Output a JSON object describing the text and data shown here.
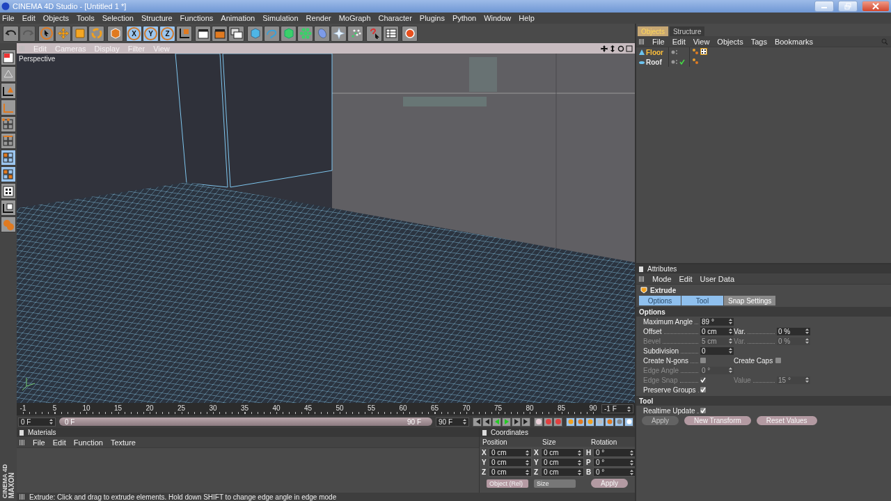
{
  "window": {
    "title": "CINEMA 4D Studio - [Untitled 1 *]"
  },
  "menu": [
    "File",
    "Edit",
    "Objects",
    "Tools",
    "Selection",
    "Structure",
    "Functions",
    "Animation",
    "Simulation",
    "Render",
    "MoGraph",
    "Character",
    "Plugins",
    "Python",
    "Window",
    "Help"
  ],
  "toolbar": [
    [
      {
        "kind": "undo",
        "active": false
      },
      {
        "kind": "redo",
        "active": false
      }
    ],
    [
      {
        "kind": "select",
        "active": false
      },
      {
        "kind": "move",
        "active": false
      },
      {
        "kind": "scale",
        "active": false
      },
      {
        "kind": "rotate",
        "active": false
      }
    ],
    [
      {
        "kind": "object",
        "active": false
      }
    ],
    [
      {
        "kind": "axis",
        "label": "X",
        "active": true
      },
      {
        "kind": "axis",
        "label": "Y",
        "active": true
      },
      {
        "kind": "axis",
        "label": "Z",
        "active": true
      },
      {
        "kind": "coords",
        "active": false
      }
    ],
    [
      {
        "kind": "render-view",
        "active": false
      },
      {
        "kind": "render",
        "active": false
      },
      {
        "kind": "render-settings",
        "active": false
      }
    ],
    [
      {
        "kind": "cube",
        "active": false
      },
      {
        "kind": "spline",
        "active": false
      },
      {
        "kind": "nurbs",
        "active": false
      },
      {
        "kind": "array",
        "active": false
      },
      {
        "kind": "deformer",
        "active": false
      },
      {
        "kind": "light",
        "active": false
      },
      {
        "kind": "particles",
        "active": false
      }
    ],
    [
      {
        "kind": "help",
        "active": false
      },
      {
        "kind": "layout",
        "active": false
      }
    ],
    [
      {
        "kind": "record",
        "active": false
      }
    ]
  ],
  "left_tools": [
    {
      "kind": "layout",
      "active": false
    },
    {
      "kind": "texture",
      "active": false
    },
    {
      "kind": "object-axis",
      "active": false
    },
    {
      "kind": "model",
      "active": false
    },
    {
      "kind": "points",
      "active": false
    },
    {
      "kind": "edges",
      "active": false
    },
    {
      "kind": "polygons",
      "active": true
    },
    {
      "kind": "uv",
      "active": true
    },
    {
      "kind": "checker",
      "active": false
    },
    {
      "kind": "checker-axis",
      "active": false
    },
    {
      "kind": "sculpt",
      "active": false
    }
  ],
  "viewport": {
    "menu": [
      "Edit",
      "Cameras",
      "Display",
      "Filter",
      "View"
    ],
    "label": "Perspective"
  },
  "timeline": {
    "ticks": [
      "-1",
      "5",
      "10",
      "15",
      "20",
      "25",
      "30",
      "35",
      "40",
      "45",
      "50",
      "55",
      "60",
      "65",
      "70",
      "75",
      "80",
      "85",
      "90"
    ],
    "frame_field": "-1 F",
    "start_field": "0 F",
    "range": {
      "start": "0 F",
      "end": "90 F",
      "level": 1
    },
    "end_field": "90 F"
  },
  "materials": {
    "title": "Materials",
    "menu": [
      "File",
      "Edit",
      "Function",
      "Texture"
    ]
  },
  "coordinates": {
    "title": "Coordinates",
    "headers": [
      "Position",
      "Size",
      "Rotation"
    ],
    "rows": [
      [
        {
          "axis": "X",
          "value": "0 cm"
        },
        {
          "axis": "X",
          "value": "0 cm"
        },
        {
          "axis": "H",
          "value": "0 °"
        }
      ],
      [
        {
          "axis": "Y",
          "value": "0 cm"
        },
        {
          "axis": "Y",
          "value": "0 cm"
        },
        {
          "axis": "P",
          "value": "0 °"
        }
      ],
      [
        {
          "axis": "Z",
          "value": "0 cm"
        },
        {
          "axis": "Z",
          "value": "0 cm"
        },
        {
          "axis": "B",
          "value": "0 °"
        }
      ]
    ],
    "mode": "Object (Rel)",
    "size_mode": "Size",
    "apply": "Apply"
  },
  "status": "Extrude: Click and drag to extrude elements. Hold down SHIFT to change edge angle in edge mode",
  "logo": [
    "MAXON",
    "CINEMA 4D"
  ],
  "objects": {
    "tabs": [
      {
        "label": "Objects",
        "selected": true
      },
      {
        "label": "Structure",
        "selected": false
      }
    ],
    "menu": [
      "File",
      "Edit",
      "View",
      "Objects",
      "Tags",
      "Bookmarks"
    ],
    "tree": [
      {
        "name": "Floor",
        "kind": "cone",
        "selected": true,
        "checked": false,
        "tags": [
          {
            "kind": "phong"
          },
          {
            "kind": "texture"
          }
        ]
      },
      {
        "name": "Roof",
        "kind": "disc",
        "selected": false,
        "checked": true,
        "tags": [
          {
            "kind": "phong"
          }
        ]
      }
    ]
  },
  "attributes": {
    "title": "Attributes",
    "menu": [
      "Mode",
      "Edit",
      "User Data"
    ],
    "object": "Extrude",
    "tabs": [
      {
        "label": "Options",
        "selected": true
      },
      {
        "label": "Tool",
        "selected": true
      },
      {
        "label": "Snap Settings",
        "selected": false
      }
    ],
    "sections": [
      {
        "title": "Options",
        "rows": [
          {
            "params": [
              {
                "kind": "field",
                "label": "Maximum Angle",
                "value": "89 °",
                "disabled": false
              }
            ]
          },
          {
            "params": [
              {
                "kind": "field",
                "label": "Offset",
                "value": "0 cm",
                "disabled": false
              },
              {
                "kind": "field",
                "label": "Var.",
                "value": "0 %",
                "disabled": false
              }
            ]
          },
          {
            "params": [
              {
                "kind": "field",
                "label": "Bevel",
                "value": "5 cm",
                "disabled": true
              },
              {
                "kind": "field",
                "label": "Var.",
                "value": "0 %",
                "disabled": true
              }
            ]
          },
          {
            "params": [
              {
                "kind": "field",
                "label": "Subdivision",
                "value": "0",
                "disabled": false
              }
            ]
          },
          {
            "params": [
              {
                "kind": "check",
                "label": "Create N-gons",
                "checked": false,
                "disabled": false
              },
              {
                "kind": "check",
                "label": "Create Caps",
                "checked": false,
                "disabled": false
              }
            ]
          },
          {
            "params": [
              {
                "kind": "field",
                "label": "Edge Angle",
                "value": "0 °",
                "disabled": true
              }
            ]
          },
          {
            "params": [
              {
                "kind": "check",
                "label": "Edge Snap",
                "checked": true,
                "disabled": true
              },
              {
                "kind": "field",
                "label": "Value",
                "value": "15 °",
                "disabled": true
              }
            ]
          },
          {
            "params": [
              {
                "kind": "check",
                "label": "Preserve Groups",
                "checked": true,
                "disabled": false
              }
            ]
          }
        ]
      },
      {
        "title": "Tool",
        "rows": [
          {
            "params": [
              {
                "kind": "check",
                "label": "Realtime Update",
                "checked": true,
                "disabled": false
              }
            ]
          }
        ],
        "buttons": [
          {
            "label": "Apply",
            "disabled": true
          },
          {
            "label": "New Transform",
            "disabled": false
          },
          {
            "label": "Reset Values",
            "disabled": false
          }
        ]
      }
    ]
  }
}
